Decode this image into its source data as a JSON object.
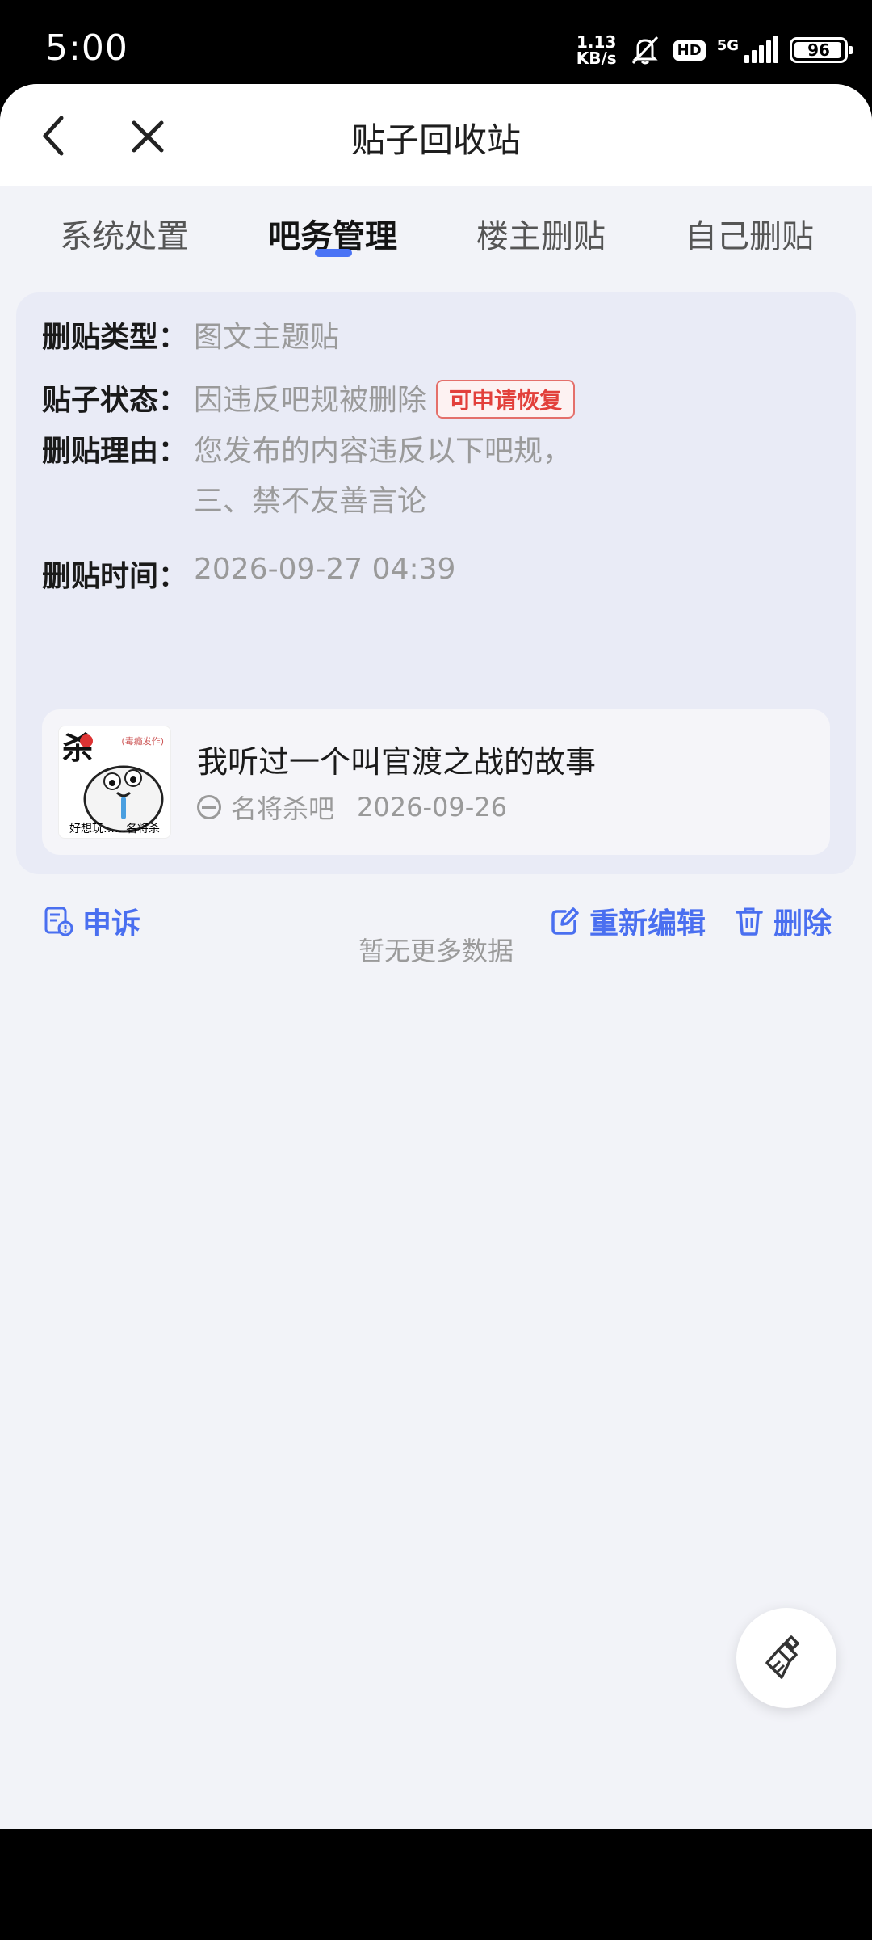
{
  "status_bar": {
    "time": "5:00",
    "net_speed_value": "1.13",
    "net_speed_unit": "KB/s",
    "hd": "HD",
    "network": "5G",
    "battery": "96"
  },
  "nav": {
    "title": "贴子回收站"
  },
  "tabs": [
    {
      "label": "系统处置"
    },
    {
      "label": "吧务管理"
    },
    {
      "label": "楼主删贴"
    },
    {
      "label": "自己删贴"
    }
  ],
  "record": {
    "type_label": "删贴类型：",
    "type_value": "图文主题贴",
    "status_label": "贴子状态：",
    "status_value": "因违反吧规被删除",
    "status_tag": "可申请恢复",
    "reason_label": "删贴理由：",
    "reason_line1": "您发布的内容违反以下吧规，",
    "reason_line2": "三、禁不友善言论",
    "time_label": "删贴时间：",
    "time_value": "2026-09-27 04:39"
  },
  "post": {
    "title": "我听过一个叫官渡之战的故事",
    "forum": "名将杀吧",
    "date": "2026-09-26",
    "thumb_caption": "好想玩……名将杀",
    "thumb_note": "(毒瘾发作)",
    "thumb_char": "杀"
  },
  "actions": {
    "appeal": "申诉",
    "re_edit": "重新编辑",
    "delete": "删除"
  },
  "footer_text": "暂无更多数据",
  "colors": {
    "accent": "#4a73f5",
    "tag_red": "#e2403b",
    "page_bg": "#f2f3f8",
    "card_bg": "#e9ebf6"
  }
}
